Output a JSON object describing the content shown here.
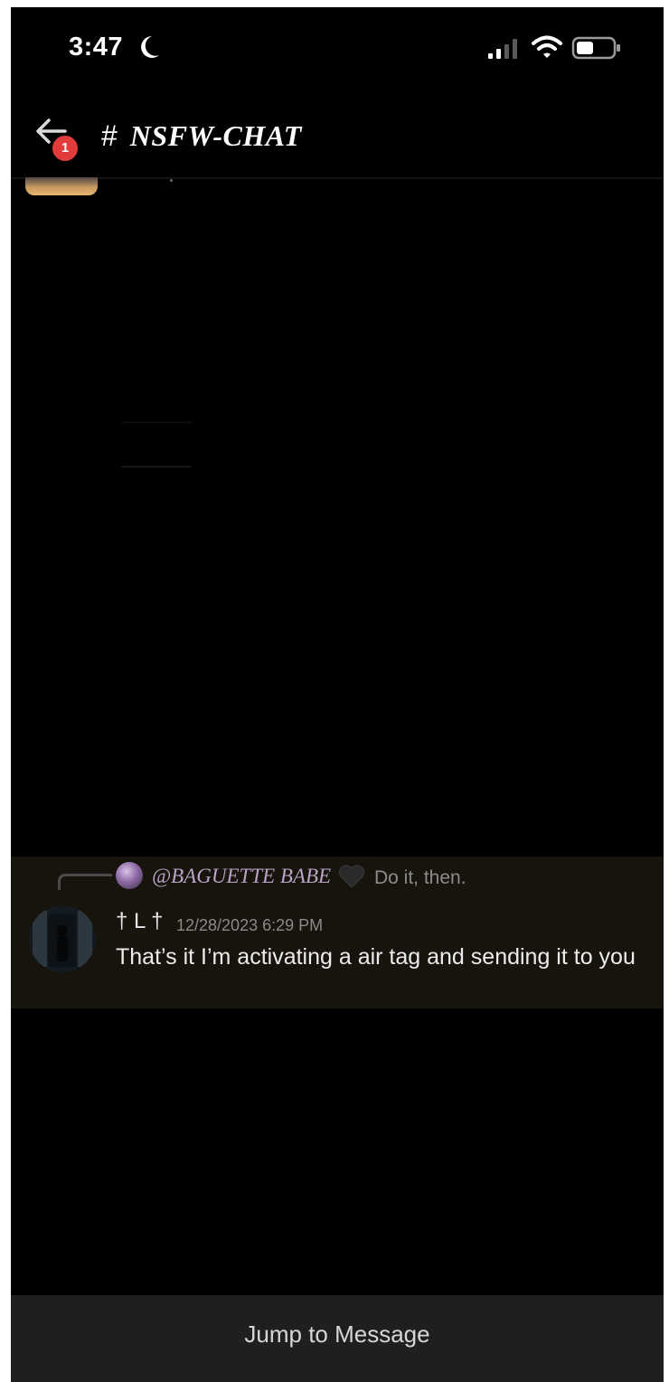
{
  "status_bar": {
    "time": "3:47",
    "moon_icon": "moon-icon",
    "signal_icon": "cellular-signal-icon",
    "wifi_icon": "wifi-icon",
    "battery_icon": "battery-icon"
  },
  "header": {
    "back_icon": "back-arrow-icon",
    "unread_badge": "1",
    "hash_symbol": "#",
    "channel_name": "NSFW-CHAT"
  },
  "message": {
    "reply": {
      "author": "@BAGUETTE BABE",
      "emoji": "black-heart",
      "content": "Do it, then."
    },
    "author": "† L †",
    "timestamp": "12/28/2023 6:29 PM",
    "text": "That’s it I’m activating a air tag and sending it to you"
  },
  "footer": {
    "jump_label": "Jump to Message"
  },
  "colors": {
    "background": "#000000",
    "highlight": "#17140d",
    "badge": "#e23b3b",
    "footer_bar": "#1e1f21"
  }
}
